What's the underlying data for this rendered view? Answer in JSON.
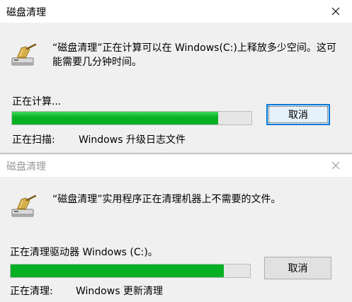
{
  "dialogs": [
    {
      "title": "磁盘清理",
      "message": "“磁盘清理”正在计算可以在 Windows(C:)上释放多少空间。这可能需要几分钟时间。",
      "status": "正在计算...",
      "progress": 0.86,
      "button": "取消",
      "detail_label": "正在扫描:",
      "detail_value": "Windows 升级日志文件",
      "icon": "disk-cleanup-icon",
      "state": "active"
    },
    {
      "title": "磁盘清理",
      "message": "“磁盘清理”实用程序正在清理机器上不需要的文件。",
      "status": "正在清理驱动器 Windows (C:)。",
      "progress": 0.89,
      "button": "取消",
      "detail_label": "正在清理:",
      "detail_value": "Windows 更新清理",
      "icon": "disk-cleanup-icon",
      "state": "inactive"
    }
  ],
  "colors": {
    "progress_fill": "#06b025",
    "focus_border": "#0078d7",
    "window_bg": "#f0f0f0",
    "inactive_title": "#999999"
  }
}
